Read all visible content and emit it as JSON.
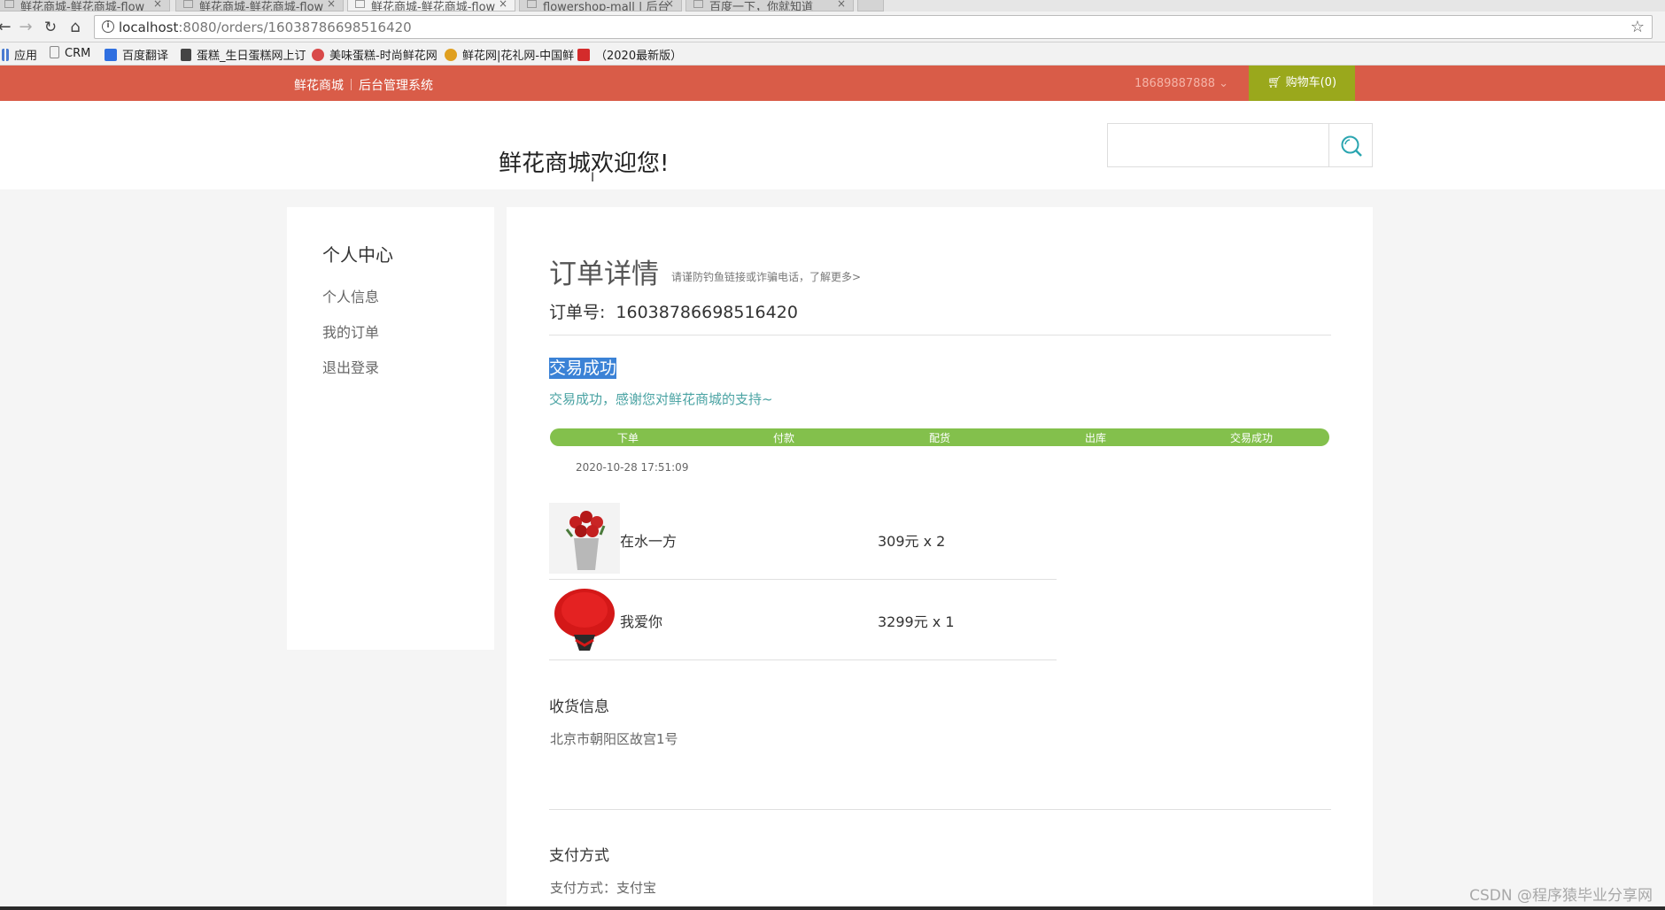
{
  "browser": {
    "tabs": [
      {
        "title": "鲜花商城-鲜花商城-flow"
      },
      {
        "title": "鲜花商城-鲜花商城-flow"
      },
      {
        "title": "鲜花商城-鲜花商城-flow"
      },
      {
        "title": "flowershop-mall | 后台"
      },
      {
        "title": "百度一下，你就知道"
      }
    ],
    "url_host": "localhost",
    "url_rest": ":8080/orders/16038786698516420",
    "bookmarks": [
      {
        "label": "应用",
        "icon": "apps-grid-icon",
        "color": "#4a7bd1"
      },
      {
        "label": "CRM",
        "icon": "page-icon",
        "color": "#cccccc"
      },
      {
        "label": "百度翻译",
        "icon": "translate-icon",
        "color": "#2f6fe0"
      },
      {
        "label": "蛋糕_生日蛋糕网上订",
        "icon": "cake-icon",
        "color": "#333333"
      },
      {
        "label": "美味蛋糕-时尚鲜花网",
        "icon": "rose-icon",
        "color": "#d94a4a"
      },
      {
        "label": "鲜花网|花礼网-中国鲜",
        "icon": "flower-icon",
        "color": "#e0a020"
      },
      {
        "label": "（2020最新版）",
        "icon": "c-logo-icon",
        "color": "#d42b2b"
      }
    ]
  },
  "topbar": {
    "home_link": "鲜花商城",
    "admin_link": "后台管理系统",
    "user": "18689887888",
    "cart": "购物车(0)",
    "color": "#d95c48",
    "cart_color": "#9aa81c"
  },
  "header": {
    "welcome": "鲜花商城欢迎您!",
    "search_placeholder": ""
  },
  "sidebar": {
    "title": "个人中心",
    "items": [
      {
        "label": "个人信息"
      },
      {
        "label": "我的订单"
      },
      {
        "label": "退出登录"
      }
    ]
  },
  "order": {
    "heading": "订单详情",
    "tip": "请谨防钓鱼链接或诈骗电话，了解更多>",
    "order_no_label": "订单号:",
    "order_no": "16038786698516420",
    "status": "交易成功",
    "status_msg": "交易成功，感谢您对鲜花商城的支持~",
    "steps": [
      "下单",
      "付款",
      "配货",
      "出库",
      "交易成功"
    ],
    "timestamp": "2020-10-28 17:51:09",
    "items": [
      {
        "name": "在水一方",
        "price": "309元 x 2"
      },
      {
        "name": "我爱你",
        "price": "3299元 x 1"
      }
    ],
    "shipping_title": "收货信息",
    "shipping_address": "北京市朝阳区故宫1号",
    "payment_title": "支付方式",
    "payment_method": "支付方式：支付宝"
  },
  "watermark": "CSDN @程序猿毕业分享网"
}
